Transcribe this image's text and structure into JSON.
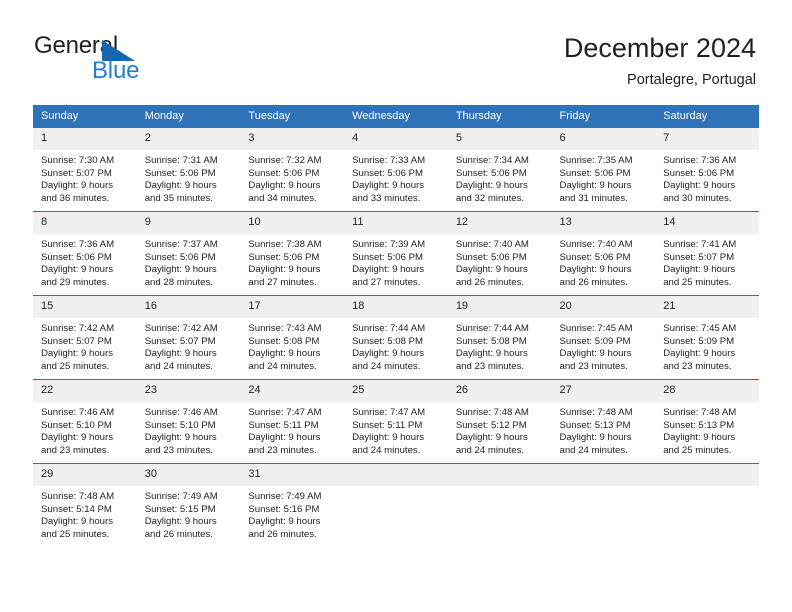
{
  "brand": {
    "name_part1": "General",
    "name_part2": "Blue",
    "triangle_color": "#1565b0",
    "blue_color": "#1e7fd4"
  },
  "header": {
    "title": "December 2024",
    "subtitle": "Portalegre, Portugal"
  },
  "theme": {
    "header_blue": "#2e72b8",
    "daynum_band": "#f0f0f0",
    "text": "#231f20"
  },
  "columns": [
    "Sunday",
    "Monday",
    "Tuesday",
    "Wednesday",
    "Thursday",
    "Friday",
    "Saturday"
  ],
  "weeks": [
    [
      {
        "day": "1",
        "sunrise": "Sunrise: 7:30 AM",
        "sunset": "Sunset: 5:07 PM",
        "daylight1": "Daylight: 9 hours",
        "daylight2": "and 36 minutes."
      },
      {
        "day": "2",
        "sunrise": "Sunrise: 7:31 AM",
        "sunset": "Sunset: 5:06 PM",
        "daylight1": "Daylight: 9 hours",
        "daylight2": "and 35 minutes."
      },
      {
        "day": "3",
        "sunrise": "Sunrise: 7:32 AM",
        "sunset": "Sunset: 5:06 PM",
        "daylight1": "Daylight: 9 hours",
        "daylight2": "and 34 minutes."
      },
      {
        "day": "4",
        "sunrise": "Sunrise: 7:33 AM",
        "sunset": "Sunset: 5:06 PM",
        "daylight1": "Daylight: 9 hours",
        "daylight2": "and 33 minutes."
      },
      {
        "day": "5",
        "sunrise": "Sunrise: 7:34 AM",
        "sunset": "Sunset: 5:06 PM",
        "daylight1": "Daylight: 9 hours",
        "daylight2": "and 32 minutes."
      },
      {
        "day": "6",
        "sunrise": "Sunrise: 7:35 AM",
        "sunset": "Sunset: 5:06 PM",
        "daylight1": "Daylight: 9 hours",
        "daylight2": "and 31 minutes."
      },
      {
        "day": "7",
        "sunrise": "Sunrise: 7:36 AM",
        "sunset": "Sunset: 5:06 PM",
        "daylight1": "Daylight: 9 hours",
        "daylight2": "and 30 minutes."
      }
    ],
    [
      {
        "day": "8",
        "sunrise": "Sunrise: 7:36 AM",
        "sunset": "Sunset: 5:06 PM",
        "daylight1": "Daylight: 9 hours",
        "daylight2": "and 29 minutes."
      },
      {
        "day": "9",
        "sunrise": "Sunrise: 7:37 AM",
        "sunset": "Sunset: 5:06 PM",
        "daylight1": "Daylight: 9 hours",
        "daylight2": "and 28 minutes."
      },
      {
        "day": "10",
        "sunrise": "Sunrise: 7:38 AM",
        "sunset": "Sunset: 5:06 PM",
        "daylight1": "Daylight: 9 hours",
        "daylight2": "and 27 minutes."
      },
      {
        "day": "11",
        "sunrise": "Sunrise: 7:39 AM",
        "sunset": "Sunset: 5:06 PM",
        "daylight1": "Daylight: 9 hours",
        "daylight2": "and 27 minutes."
      },
      {
        "day": "12",
        "sunrise": "Sunrise: 7:40 AM",
        "sunset": "Sunset: 5:06 PM",
        "daylight1": "Daylight: 9 hours",
        "daylight2": "and 26 minutes."
      },
      {
        "day": "13",
        "sunrise": "Sunrise: 7:40 AM",
        "sunset": "Sunset: 5:06 PM",
        "daylight1": "Daylight: 9 hours",
        "daylight2": "and 26 minutes."
      },
      {
        "day": "14",
        "sunrise": "Sunrise: 7:41 AM",
        "sunset": "Sunset: 5:07 PM",
        "daylight1": "Daylight: 9 hours",
        "daylight2": "and 25 minutes."
      }
    ],
    [
      {
        "day": "15",
        "sunrise": "Sunrise: 7:42 AM",
        "sunset": "Sunset: 5:07 PM",
        "daylight1": "Daylight: 9 hours",
        "daylight2": "and 25 minutes."
      },
      {
        "day": "16",
        "sunrise": "Sunrise: 7:42 AM",
        "sunset": "Sunset: 5:07 PM",
        "daylight1": "Daylight: 9 hours",
        "daylight2": "and 24 minutes."
      },
      {
        "day": "17",
        "sunrise": "Sunrise: 7:43 AM",
        "sunset": "Sunset: 5:08 PM",
        "daylight1": "Daylight: 9 hours",
        "daylight2": "and 24 minutes."
      },
      {
        "day": "18",
        "sunrise": "Sunrise: 7:44 AM",
        "sunset": "Sunset: 5:08 PM",
        "daylight1": "Daylight: 9 hours",
        "daylight2": "and 24 minutes."
      },
      {
        "day": "19",
        "sunrise": "Sunrise: 7:44 AM",
        "sunset": "Sunset: 5:08 PM",
        "daylight1": "Daylight: 9 hours",
        "daylight2": "and 23 minutes."
      },
      {
        "day": "20",
        "sunrise": "Sunrise: 7:45 AM",
        "sunset": "Sunset: 5:09 PM",
        "daylight1": "Daylight: 9 hours",
        "daylight2": "and 23 minutes."
      },
      {
        "day": "21",
        "sunrise": "Sunrise: 7:45 AM",
        "sunset": "Sunset: 5:09 PM",
        "daylight1": "Daylight: 9 hours",
        "daylight2": "and 23 minutes."
      }
    ],
    [
      {
        "day": "22",
        "sunrise": "Sunrise: 7:46 AM",
        "sunset": "Sunset: 5:10 PM",
        "daylight1": "Daylight: 9 hours",
        "daylight2": "and 23 minutes."
      },
      {
        "day": "23",
        "sunrise": "Sunrise: 7:46 AM",
        "sunset": "Sunset: 5:10 PM",
        "daylight1": "Daylight: 9 hours",
        "daylight2": "and 23 minutes."
      },
      {
        "day": "24",
        "sunrise": "Sunrise: 7:47 AM",
        "sunset": "Sunset: 5:11 PM",
        "daylight1": "Daylight: 9 hours",
        "daylight2": "and 23 minutes."
      },
      {
        "day": "25",
        "sunrise": "Sunrise: 7:47 AM",
        "sunset": "Sunset: 5:11 PM",
        "daylight1": "Daylight: 9 hours",
        "daylight2": "and 24 minutes."
      },
      {
        "day": "26",
        "sunrise": "Sunrise: 7:48 AM",
        "sunset": "Sunset: 5:12 PM",
        "daylight1": "Daylight: 9 hours",
        "daylight2": "and 24 minutes."
      },
      {
        "day": "27",
        "sunrise": "Sunrise: 7:48 AM",
        "sunset": "Sunset: 5:13 PM",
        "daylight1": "Daylight: 9 hours",
        "daylight2": "and 24 minutes."
      },
      {
        "day": "28",
        "sunrise": "Sunrise: 7:48 AM",
        "sunset": "Sunset: 5:13 PM",
        "daylight1": "Daylight: 9 hours",
        "daylight2": "and 25 minutes."
      }
    ],
    [
      {
        "day": "29",
        "sunrise": "Sunrise: 7:48 AM",
        "sunset": "Sunset: 5:14 PM",
        "daylight1": "Daylight: 9 hours",
        "daylight2": "and 25 minutes."
      },
      {
        "day": "30",
        "sunrise": "Sunrise: 7:49 AM",
        "sunset": "Sunset: 5:15 PM",
        "daylight1": "Daylight: 9 hours",
        "daylight2": "and 26 minutes."
      },
      {
        "day": "31",
        "sunrise": "Sunrise: 7:49 AM",
        "sunset": "Sunset: 5:16 PM",
        "daylight1": "Daylight: 9 hours",
        "daylight2": "and 26 minutes."
      },
      {
        "day": "",
        "sunrise": "",
        "sunset": "",
        "daylight1": "",
        "daylight2": ""
      },
      {
        "day": "",
        "sunrise": "",
        "sunset": "",
        "daylight1": "",
        "daylight2": ""
      },
      {
        "day": "",
        "sunrise": "",
        "sunset": "",
        "daylight1": "",
        "daylight2": ""
      },
      {
        "day": "",
        "sunrise": "",
        "sunset": "",
        "daylight1": "",
        "daylight2": ""
      }
    ]
  ]
}
